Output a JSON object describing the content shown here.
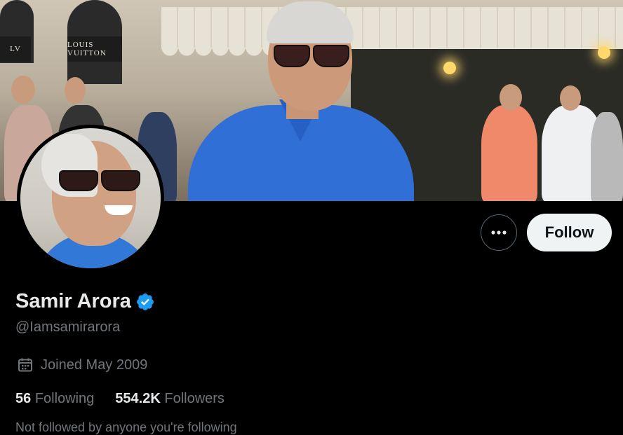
{
  "banner": {
    "store_sign": "LOUIS VUITTON",
    "store_sign_short": "LV"
  },
  "profile": {
    "name": "Samir Arora",
    "handle": "@Iamsamirarora",
    "joined": "Joined May 2009",
    "verified_color": "#1d9bf0"
  },
  "actions": {
    "follow_label": "Follow",
    "more_label": "•••"
  },
  "stats": {
    "following_count": "56",
    "following_label": "Following",
    "followers_count": "554.2K",
    "followers_label": "Followers"
  },
  "footer": {
    "partial_text": "Not followed by anyone you're following"
  }
}
